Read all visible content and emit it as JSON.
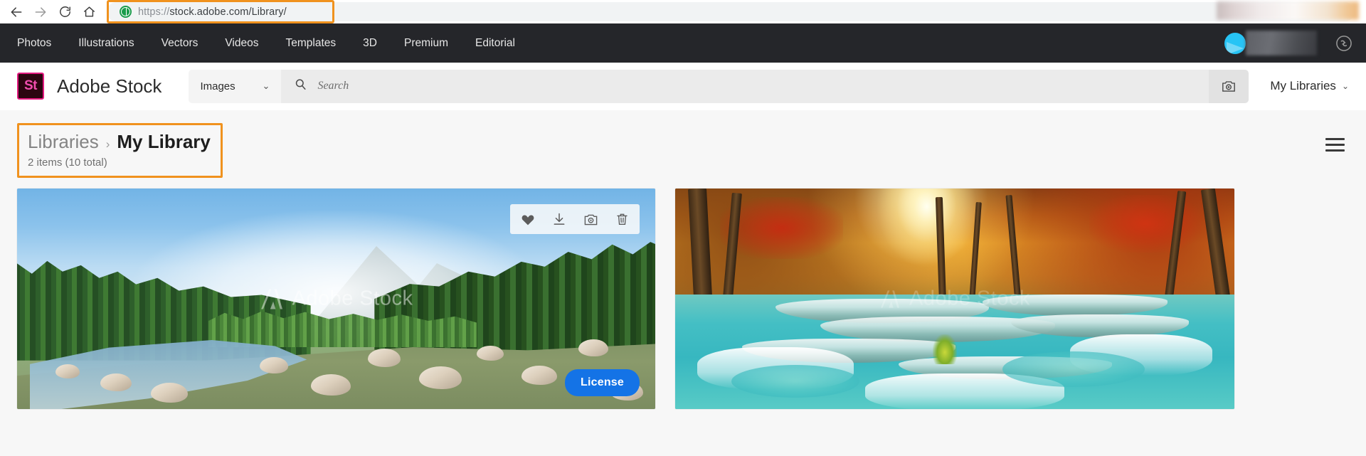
{
  "browser": {
    "back_label": "Back",
    "forward_label": "Forward",
    "reload_label": "Reload",
    "home_label": "Home",
    "url": "https://stock.adobe.com/Library/",
    "url_scheme": "https://",
    "url_rest": "stock.adobe.com/Library/",
    "site_icon": "globe-icon"
  },
  "topnav": {
    "items": [
      {
        "label": "Photos"
      },
      {
        "label": "Illustrations"
      },
      {
        "label": "Vectors"
      },
      {
        "label": "Videos"
      },
      {
        "label": "Templates"
      },
      {
        "label": "3D"
      },
      {
        "label": "Premium"
      },
      {
        "label": "Editorial"
      }
    ],
    "avatar_label": "Creative Cloud account avatar",
    "cc_icon": "creative-cloud-icon"
  },
  "header": {
    "logo_text": "St",
    "brand": "Adobe Stock",
    "search_type": "Images",
    "search_placeholder": "Search",
    "search_value": "",
    "visual_search_icon": "camera-icon",
    "my_libraries": "My Libraries"
  },
  "breadcrumb": {
    "parent": "Libraries",
    "separator": "›",
    "current": "My Library",
    "count": "2 items (10 total)",
    "highlight_color": "#f0921e"
  },
  "toolbar": {
    "menu_label": "Menu",
    "menu_icon": "hamburger-icon"
  },
  "assets": [
    {
      "name": "mountain-river-forest",
      "watermark": "Adobe Stock",
      "selected": true,
      "license_label": "License",
      "hover_tools": [
        {
          "icon": "heart-icon",
          "label": "Favorite"
        },
        {
          "icon": "download-icon",
          "label": "Download"
        },
        {
          "icon": "camera-icon",
          "label": "Find similar"
        },
        {
          "icon": "trash-icon",
          "label": "Delete"
        }
      ]
    },
    {
      "name": "autumn-waterfall",
      "watermark": "Adobe Stock",
      "selected": false,
      "license_label": "",
      "hover_tools": []
    }
  ],
  "colors": {
    "accent_blue": "#1473e6",
    "highlight_orange": "#f0921e",
    "dark_nav": "#25262a",
    "page_bg": "#f7f7f7",
    "stock_pink": "#e3197f"
  }
}
